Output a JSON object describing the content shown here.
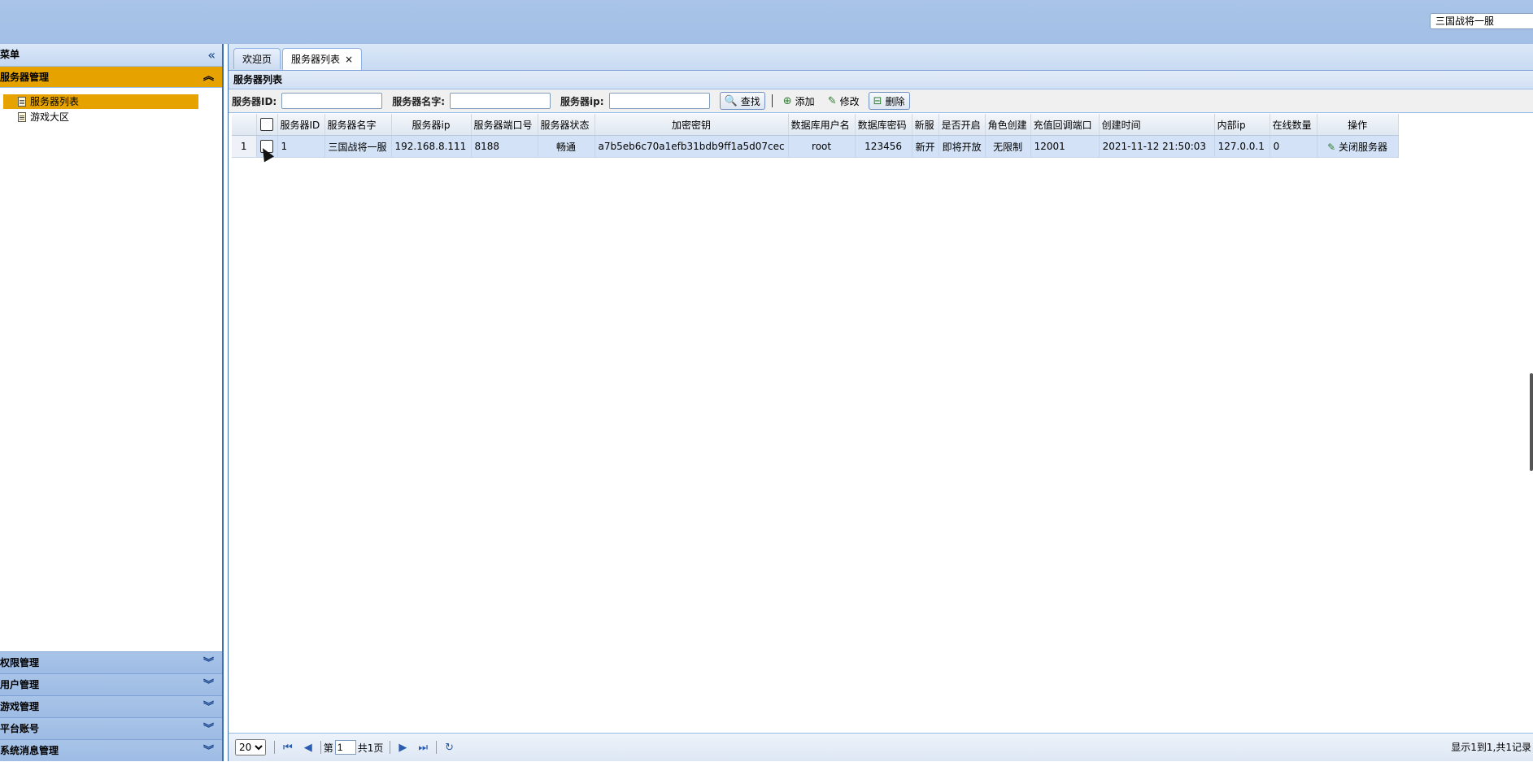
{
  "header": {
    "server_select_value": "三国战将一服"
  },
  "sidebar": {
    "title": "菜单",
    "active_section": "服务器管理",
    "tree_items": [
      "服务器列表",
      "游戏大区"
    ],
    "collapsed_sections": [
      "权限管理",
      "用户管理",
      "游戏管理",
      "平台账号",
      "系统消息管理"
    ]
  },
  "tabs": [
    {
      "label": "欢迎页",
      "active": false
    },
    {
      "label": "服务器列表",
      "active": true,
      "close": "×"
    }
  ],
  "panel": {
    "title": "服务器列表"
  },
  "toolbar": {
    "server_id_label": "服务器ID:",
    "server_name_label": "服务器名字:",
    "server_ip_label": "服务器ip:",
    "search_label": "查找",
    "add_label": "添加",
    "edit_label": "修改",
    "delete_label": "删除"
  },
  "grid": {
    "columns": [
      "服务器ID",
      "服务器名字",
      "服务器ip",
      "服务器端口号",
      "服务器状态",
      "加密密钥",
      "数据库用户名",
      "数据库密码",
      "新服",
      "是否开启",
      "角色创建",
      "充值回调端口",
      "创建时间",
      "内部ip",
      "在线数量",
      "操作"
    ],
    "rows": [
      {
        "rownum": "1",
        "cells": [
          "1",
          "三国战将一服",
          "192.168.8.111",
          "8188",
          "畅通",
          "a7b5eb6c70a1efb31bdb9ff1a5d07cec",
          "root",
          "123456",
          "新开",
          "即将开放",
          "无限制",
          "12001",
          "2021-11-12 21:50:03",
          "127.0.0.1",
          "0"
        ],
        "action_label": "关闭服务器"
      }
    ]
  },
  "pager": {
    "page_size": "20",
    "page_prefix": "第",
    "page_value": "1",
    "page_total": "共1页",
    "info": "显示1到1,共1记录"
  }
}
